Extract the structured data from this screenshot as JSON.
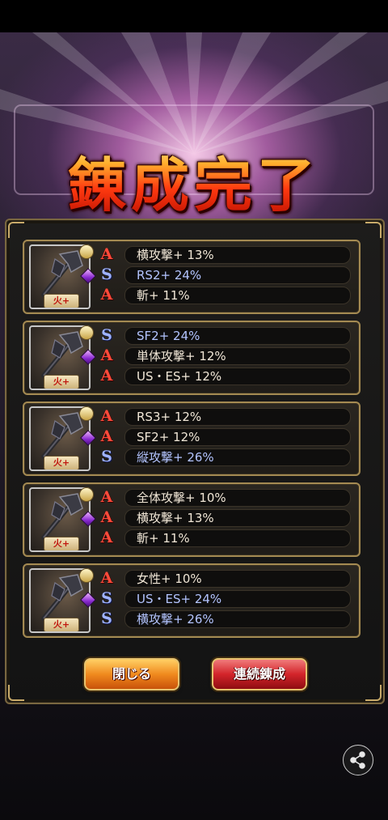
{
  "title": "錬成完了",
  "results": [
    {
      "rarity_label": "火+",
      "stats": [
        {
          "grade": "A",
          "text": "横攻撃+ 13%"
        },
        {
          "grade": "S",
          "text": "RS2+ 24%"
        },
        {
          "grade": "A",
          "text": "斬+ 11%"
        }
      ]
    },
    {
      "rarity_label": "火+",
      "stats": [
        {
          "grade": "S",
          "text": "SF2+ 24%"
        },
        {
          "grade": "A",
          "text": "単体攻撃+ 12%"
        },
        {
          "grade": "A",
          "text": "US・ES+ 12%"
        }
      ]
    },
    {
      "rarity_label": "火+",
      "stats": [
        {
          "grade": "A",
          "text": "RS3+ 12%"
        },
        {
          "grade": "A",
          "text": "SF2+ 12%"
        },
        {
          "grade": "S",
          "text": "縦攻撃+ 26%"
        }
      ]
    },
    {
      "rarity_label": "火+",
      "stats": [
        {
          "grade": "A",
          "text": "全体攻撃+ 10%"
        },
        {
          "grade": "A",
          "text": "横攻撃+ 13%"
        },
        {
          "grade": "A",
          "text": "斬+ 11%"
        }
      ]
    },
    {
      "rarity_label": "火+",
      "stats": [
        {
          "grade": "A",
          "text": "女性+ 10%"
        },
        {
          "grade": "S",
          "text": "US・ES+ 24%"
        },
        {
          "grade": "S",
          "text": "横攻撃+ 26%"
        }
      ]
    }
  ],
  "buttons": {
    "close": "閉じる",
    "continue": "連続錬成"
  },
  "icons": {
    "share": "share-icon",
    "weapon": "axe-icon",
    "gem": "gem-icon"
  },
  "colors": {
    "grade_a": "#ff4a3a",
    "grade_s": "#9fb3ff",
    "panel_border": "#a48a52"
  }
}
